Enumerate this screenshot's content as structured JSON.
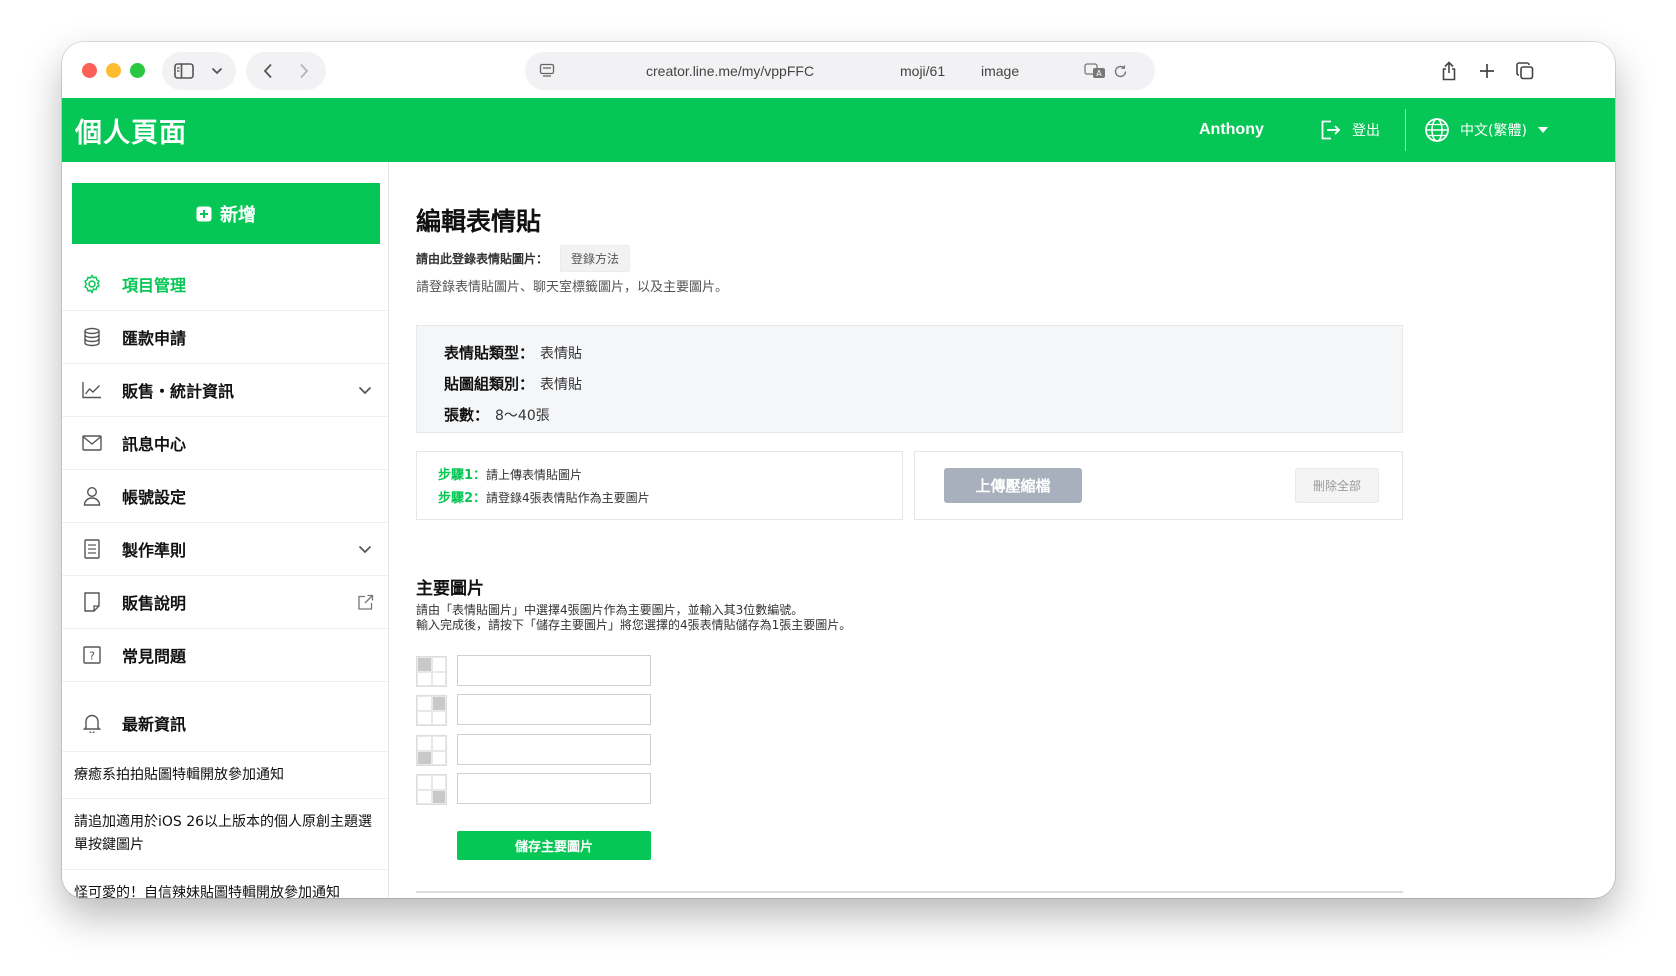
{
  "browser": {
    "url_parts": [
      "creator.line.me/my/vppFFC",
      "moji/61",
      "image"
    ]
  },
  "header": {
    "title": "個人頁面",
    "user": "Anthony",
    "logout_label": "登出",
    "language_label": "中文(繁體)"
  },
  "sidebar": {
    "new_button": "新增",
    "items": [
      {
        "label": "項目管理",
        "icon": "gear-icon",
        "active": true
      },
      {
        "label": "匯款申請",
        "icon": "coins-icon"
      },
      {
        "label": "販售・統計資訊",
        "icon": "chart-icon",
        "expandable": true
      },
      {
        "label": "訊息中心",
        "icon": "mail-icon"
      },
      {
        "label": "帳號設定",
        "icon": "user-icon"
      },
      {
        "label": "製作準則",
        "icon": "document-icon",
        "expandable": true
      },
      {
        "label": "販售說明",
        "icon": "note-icon",
        "external": true
      },
      {
        "label": "常見問題",
        "icon": "question-icon"
      }
    ],
    "news_heading": "最新資訊",
    "news": [
      "療癒系拍拍貼圖特輯開放參加通知",
      "請追加適用於iOS 26以上版本的個人原創主題選單按鍵圖片",
      "怪可愛的！自信辣妹貼圖特輯開放參加通知"
    ]
  },
  "main": {
    "title": "編輯表情貼",
    "register_label": "請由此登錄表情貼圖片：",
    "register_method_button": "登錄方法",
    "subtitle": "請登錄表情貼圖片、聊天室標籤圖片，以及主要圖片。",
    "info": {
      "type_label": "表情貼類型：",
      "type_value": "表情貼",
      "group_label": "貼圖組類別：",
      "group_value": "表情貼",
      "count_label": "張數：",
      "count_value": "8〜40張"
    },
    "steps": [
      {
        "label": "步驟1：",
        "text": "請上傳表情貼圖片"
      },
      {
        "label": "步驟2：",
        "text": "請登錄4張表情貼作為主要圖片"
      }
    ],
    "upload_button": "上傳壓縮檔",
    "delete_all_button": "刪除全部",
    "main_image": {
      "heading": "主要圖片",
      "desc_line1": "請由「表情貼圖片」中選擇4張圖片作為主要圖片，並輸入其3位數編號。",
      "desc_line2": "輸入完成後，請按下「儲存主要圖片」將您選擇的4張表情貼儲存為1張主要圖片。",
      "inputs": [
        "",
        "",
        "",
        ""
      ],
      "save_button": "儲存主要圖片"
    }
  }
}
